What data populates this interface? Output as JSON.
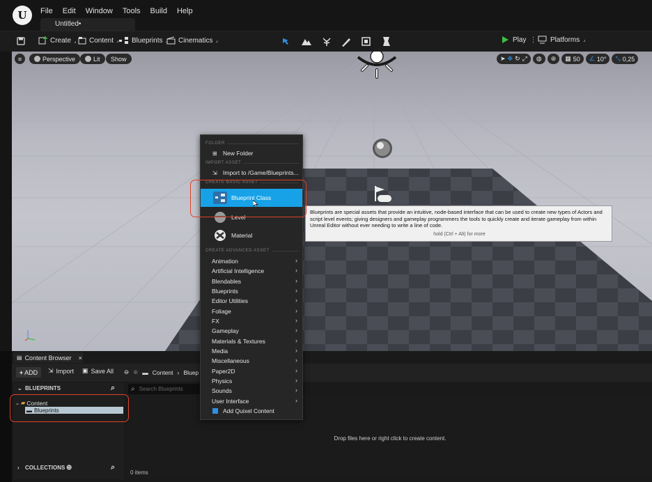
{
  "menubar": {
    "items": [
      "File",
      "Edit",
      "Window",
      "Tools",
      "Build",
      "Help"
    ],
    "document_tab": "Untitled•"
  },
  "toolbar": {
    "create": "Create",
    "content": "Content",
    "blueprints": "Blueprints",
    "cinematics": "Cinematics",
    "play": "Play",
    "platforms": "Platforms"
  },
  "viewport": {
    "perspective": "Perspective",
    "lit": "Lit",
    "show": "Show",
    "grid_snap": "50",
    "rotation_snap": "10°",
    "scale_snap": "0,25"
  },
  "context_menu": {
    "sections": {
      "folder": "FOLDER",
      "import_asset": "IMPORT ASSET",
      "create_basic_asset": "CREATE BASIC ASSET",
      "create_advanced_asset": "CREATE ADVANCED ASSET"
    },
    "new_folder": "New Folder",
    "import_to": "Import to /Game/Blueprints...",
    "blueprint_class": "Blueprint Class",
    "level": "Level",
    "material": "Material",
    "advanced_items": [
      "Animation",
      "Artificial Intelligence",
      "Blendables",
      "Blueprints",
      "Editor Utilities",
      "Foliage",
      "FX",
      "Gameplay",
      "Materials & Textures",
      "Media",
      "Miscellaneous",
      "Paper2D",
      "Physics",
      "Sounds",
      "User Interface"
    ],
    "add_quixel": "Add Quixel Content"
  },
  "tooltip": {
    "text": "Blueprints are special assets that provide an intuitive, node-based interface that can be used to create new types of Actors and script level events; giving designers and gameplay programmers the tools to quickly create and iterate gameplay from within Unreal Editor without ever needing to write a line of code.",
    "hint": "hold (Ctrl + Alt) for more"
  },
  "content_browser": {
    "tab": "Content Browser",
    "add": "ADD",
    "import": "Import",
    "save_all": "Save All",
    "breadcrumb": [
      "Content",
      "Bluep"
    ],
    "sources_title": "BLUEPRINTS",
    "tree": {
      "content": "Content",
      "blueprints": "Blueprints"
    },
    "search_placeholder": "Search Blueprints",
    "drop_hint": "Drop files here or right click to create content.",
    "items_count": "0 items",
    "collections": "COLLECTIONS"
  },
  "colors": {
    "accent": "#17a2e8",
    "highlight_outline": "#e0412b",
    "play_green": "#3fbf3f"
  }
}
